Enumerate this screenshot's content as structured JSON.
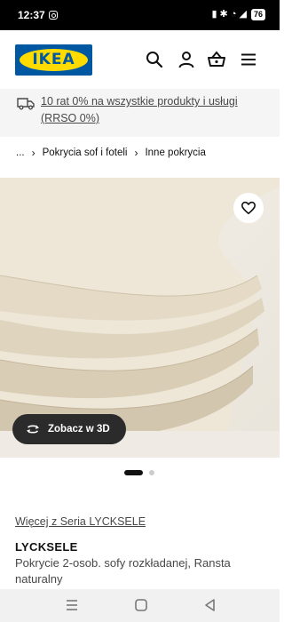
{
  "status_bar": {
    "time": "12:37",
    "battery": "76",
    "signal_glyphs": "▮ ✱ ◔ ◢"
  },
  "header": {
    "logo_text": "IKEA",
    "brand_colors": {
      "blue": "#0058a3",
      "yellow": "#ffdb00"
    },
    "icons": [
      "search-icon",
      "profile-icon",
      "basket-icon",
      "menu-icon"
    ]
  },
  "promo": {
    "icon": "truck-icon",
    "text": "10 rat 0% na wszystkie produkty i usługi (RRSO 0%)"
  },
  "breadcrumb": {
    "ellipsis": "...",
    "items": [
      "Pokrycia sof i foteli",
      "Inne pokrycia"
    ]
  },
  "product_image": {
    "favorite_icon": "heart-icon",
    "view_3d_label": "Zobacz w 3D",
    "view_3d_icon": "rotate-3d-icon",
    "carousel": {
      "total": 2,
      "active": 1
    }
  },
  "product": {
    "series_link": "Więcej z Seria LYCKSELE",
    "name": "LYCKSELE",
    "description": "Pokrycie 2-osob. sofy rozkładanej, Ransta naturalny"
  },
  "nav_bar": {
    "buttons": [
      "recents-icon",
      "home-icon",
      "back-icon"
    ]
  }
}
